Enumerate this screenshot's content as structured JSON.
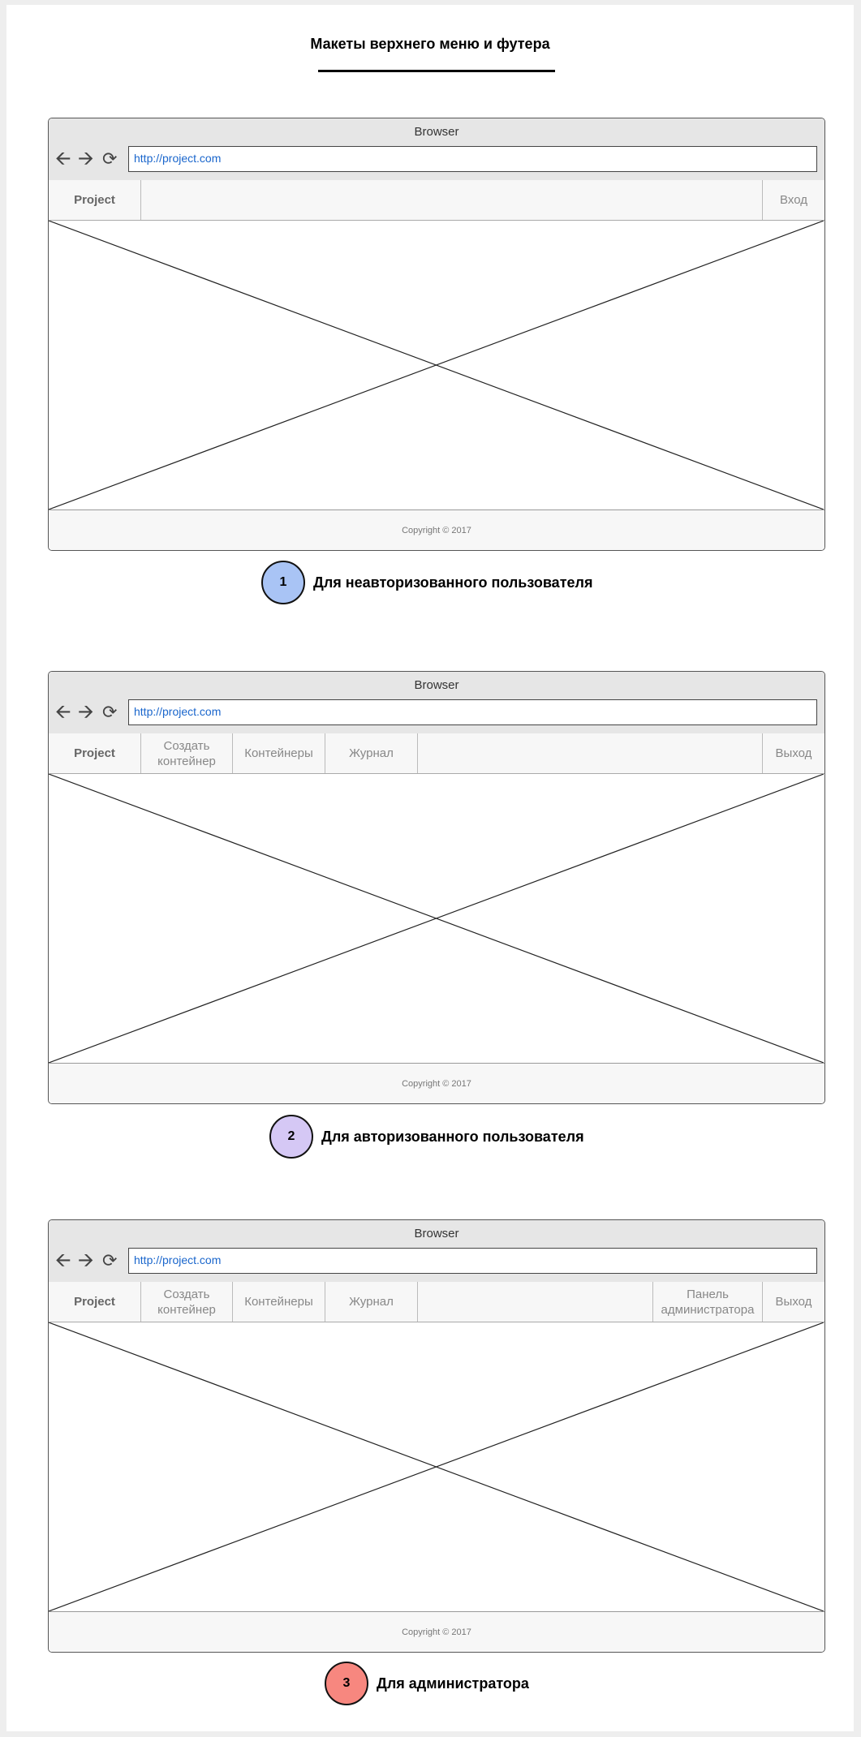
{
  "title": "Макеты верхнего меню и футера",
  "browser": {
    "title": "Browser",
    "url": "http://project.com",
    "back_icon": "arrow-left-icon",
    "forward_icon": "arrow-right-icon",
    "reload_icon": "reload-icon"
  },
  "footer_text": "Copyright © 2017",
  "mockups": [
    {
      "number": "1",
      "caption": "Для неавторизованного пользователя",
      "badge_color": "#a9c4f5",
      "brand": "Project",
      "menu": [],
      "right": [
        "Вход"
      ]
    },
    {
      "number": "2",
      "caption": "Для авторизованного пользователя",
      "badge_color": "#d5c8f5",
      "brand": "Project",
      "menu": [
        "Создать контейнер",
        "Контейнеры",
        "Журнал"
      ],
      "right": [
        "Выход"
      ]
    },
    {
      "number": "3",
      "caption": "Для администратора",
      "badge_color": "#f7877f",
      "brand": "Project",
      "menu": [
        "Создать контейнер",
        "Контейнеры",
        "Журнал"
      ],
      "right": [
        "Панель администратора",
        "Выход"
      ]
    }
  ]
}
